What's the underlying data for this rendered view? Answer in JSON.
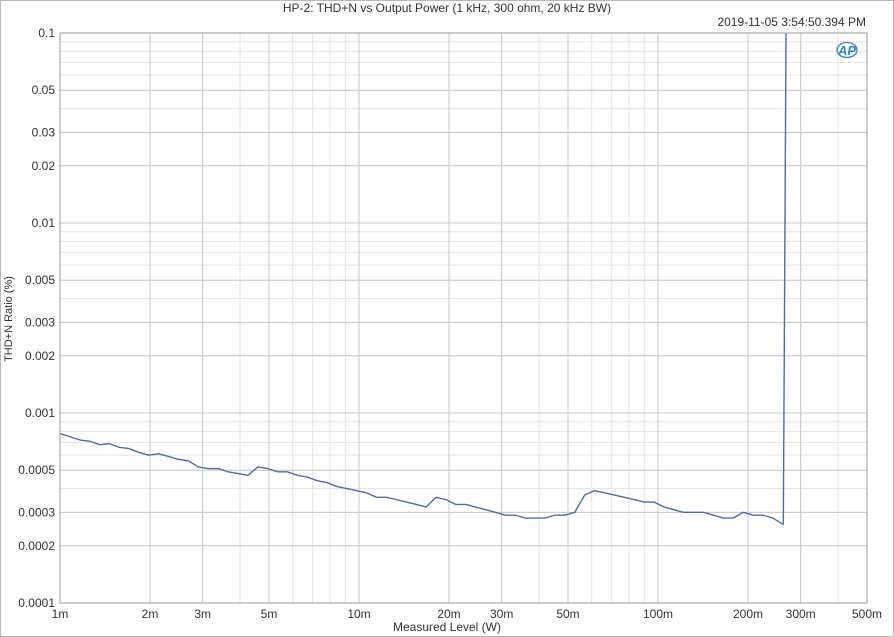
{
  "chart_data": {
    "type": "line",
    "title": "HP-2: THD+N vs Output Power (1 kHz, 300 ohm, 20 kHz BW)",
    "timestamp": "2019-11-05 3:54:50.394 PM",
    "xlabel": "Measured Level (W)",
    "ylabel": "THD+N Ratio (%)",
    "xscale": "log",
    "yscale": "log",
    "xlim": [
      0.001,
      0.5
    ],
    "ylim": [
      0.0001,
      0.1
    ],
    "grid": true,
    "logo_text": "AP",
    "x_ticks": [
      {
        "value": 0.001,
        "label": "1m"
      },
      {
        "value": 0.002,
        "label": "2m"
      },
      {
        "value": 0.003,
        "label": "3m"
      },
      {
        "value": 0.005,
        "label": "5m"
      },
      {
        "value": 0.01,
        "label": "10m"
      },
      {
        "value": 0.02,
        "label": "20m"
      },
      {
        "value": 0.03,
        "label": "30m"
      },
      {
        "value": 0.05,
        "label": "50m"
      },
      {
        "value": 0.1,
        "label": "100m"
      },
      {
        "value": 0.2,
        "label": "200m"
      },
      {
        "value": 0.3,
        "label": "300m"
      },
      {
        "value": 0.5,
        "label": "500m"
      }
    ],
    "y_ticks": [
      {
        "value": 0.1,
        "label": "0.1"
      },
      {
        "value": 0.05,
        "label": "0.05"
      },
      {
        "value": 0.03,
        "label": "0.03"
      },
      {
        "value": 0.02,
        "label": "0.02"
      },
      {
        "value": 0.01,
        "label": "0.01"
      },
      {
        "value": 0.005,
        "label": "0.005"
      },
      {
        "value": 0.003,
        "label": "0.003"
      },
      {
        "value": 0.002,
        "label": "0.002"
      },
      {
        "value": 0.001,
        "label": "0.001"
      },
      {
        "value": 0.0005,
        "label": "0.0005"
      },
      {
        "value": 0.0003,
        "label": "0.0003"
      },
      {
        "value": 0.0002,
        "label": "0.0002"
      },
      {
        "value": 0.0001,
        "label": "0.0001"
      }
    ],
    "series": [
      {
        "color": "#4a6fa5",
        "x": [
          0.001,
          0.00108,
          0.00117,
          0.00126,
          0.00136,
          0.00146,
          0.00158,
          0.0017,
          0.00184,
          0.00198,
          0.00214,
          0.00231,
          0.00249,
          0.00269,
          0.0029,
          0.00313,
          0.00338,
          0.00365,
          0.00394,
          0.00425,
          0.00459,
          0.00495,
          0.00534,
          0.00577,
          0.00622,
          0.00672,
          0.00725,
          0.00782,
          0.00844,
          0.00911,
          0.00983,
          0.0106,
          0.01145,
          0.01236,
          0.01334,
          0.0144,
          0.01554,
          0.01677,
          0.0181,
          0.01953,
          0.02108,
          0.02275,
          0.02456,
          0.0265,
          0.0286,
          0.03087,
          0.03332,
          0.03596,
          0.03881,
          0.04189,
          0.04521,
          0.0488,
          0.05266,
          0.05684,
          0.06134,
          0.06621,
          0.07146,
          0.07713,
          0.08324,
          0.08985,
          0.09697,
          0.10466,
          0.11296,
          0.12192,
          0.13158,
          0.14202,
          0.15328,
          0.16544,
          0.17856,
          0.19272,
          0.208,
          0.2245,
          0.2423,
          0.2615,
          0.2625,
          0.268
        ],
        "y": [
          0.00078,
          0.00075,
          0.00072,
          0.00071,
          0.00068,
          0.00069,
          0.00066,
          0.00065,
          0.00062,
          0.0006,
          0.00061,
          0.00059,
          0.00057,
          0.00056,
          0.00052,
          0.00051,
          0.00051,
          0.00049,
          0.00048,
          0.00047,
          0.00052,
          0.00051,
          0.00049,
          0.00049,
          0.00047,
          0.00046,
          0.00044,
          0.00043,
          0.00041,
          0.0004,
          0.00039,
          0.00038,
          0.00036,
          0.00036,
          0.00035,
          0.00034,
          0.00033,
          0.00032,
          0.00036,
          0.00035,
          0.00033,
          0.00033,
          0.00032,
          0.00031,
          0.0003,
          0.00029,
          0.00029,
          0.00028,
          0.00028,
          0.00028,
          0.00029,
          0.00029,
          0.0003,
          0.00037,
          0.00039,
          0.00038,
          0.00037,
          0.00036,
          0.00035,
          0.00034,
          0.00034,
          0.00032,
          0.00031,
          0.0003,
          0.0003,
          0.0003,
          0.00029,
          0.00028,
          0.00028,
          0.0003,
          0.00029,
          0.00029,
          0.00028,
          0.00026,
          0.00026,
          0.1
        ]
      }
    ]
  }
}
